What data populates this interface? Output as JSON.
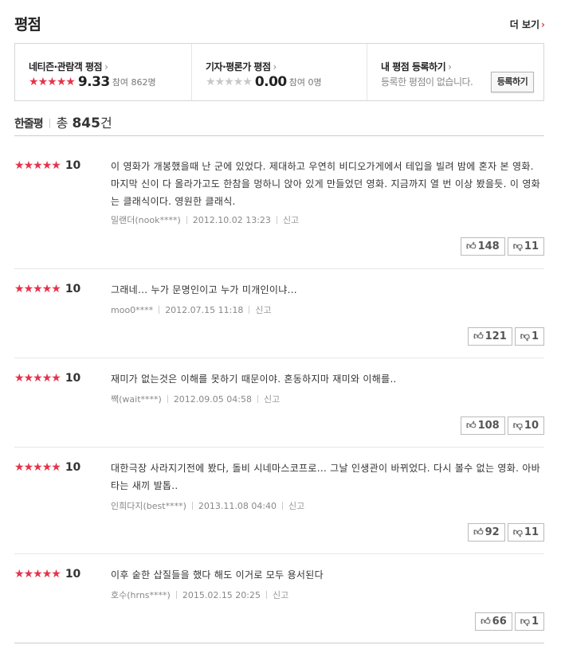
{
  "header": {
    "title": "평점",
    "more_label": "더 보기",
    "more_arrow": "›"
  },
  "summary": {
    "netizen": {
      "label": "네티즌·관람객 평점",
      "arrow": "›",
      "score": "9.33",
      "count_label": "참여 862명",
      "stars_filled": 5
    },
    "critic": {
      "label": "기자·평론가 평점",
      "arrow": "›",
      "score": "0.00",
      "count_label": "참여 0명",
      "stars_filled": 0
    },
    "mine": {
      "label": "내 평점 등록하기",
      "arrow": "›",
      "sub": "등록한 평점이 없습니다.",
      "button": "등록하기"
    }
  },
  "list": {
    "label": "한줄평",
    "total_prefix": "총 ",
    "total_num": "845",
    "total_suffix": "건"
  },
  "icons": {
    "star": "star-icon",
    "thumb_up": "thumb-up-icon",
    "thumb_down": "thumb-down-icon"
  },
  "colors": {
    "star_red": "#e5334a",
    "star_gray": "#c8c8c8"
  },
  "reviews": [
    {
      "score": "10",
      "text": "이 영화가 개봉했을때 난 군에 있었다. 제대하고 우연히 비디오가게에서 테입을 빌려 밤에 혼자 본 영화. 마지막 신이 다 올라가고도 한참을 멍하니 앉아 있게 만들었던 영화. 지금까지 열 번 이상 봤을듯. 이 영화는 클래식이다. 영원한 클래식.",
      "user": "밀랜더(nook****)",
      "date": "2012.10.02 13:23",
      "report": "신고",
      "up": "148",
      "down": "11"
    },
    {
      "score": "10",
      "text": "그래네... 누가 문명인이고 누가 미개인이냐...",
      "user": "moo0****",
      "date": "2012.07.15 11:18",
      "report": "신고",
      "up": "121",
      "down": "1"
    },
    {
      "score": "10",
      "text": "재미가 없는것은 이해를 못하기 때문이야. 혼동하지마 재미와 이해를..",
      "user": "짹(wait****)",
      "date": "2012.09.05 04:58",
      "report": "신고",
      "up": "108",
      "down": "10"
    },
    {
      "score": "10",
      "text": "대한극장 사라지기전에 봤다, 돌비 시네마스코프로... 그날 인생관이 바뀌었다. 다시 볼수 없는 영화. 아바타는 새끼 발톱..",
      "user": "인희다지(best****)",
      "date": "2013.11.08 04:40",
      "report": "신고",
      "up": "92",
      "down": "11"
    },
    {
      "score": "10",
      "text": "이후 숱한 삽질들을 했다 해도 이거로 모두 용서된다",
      "user": "호수(hrns****)",
      "date": "2015.02.15 20:25",
      "report": "신고",
      "up": "66",
      "down": "1"
    }
  ]
}
